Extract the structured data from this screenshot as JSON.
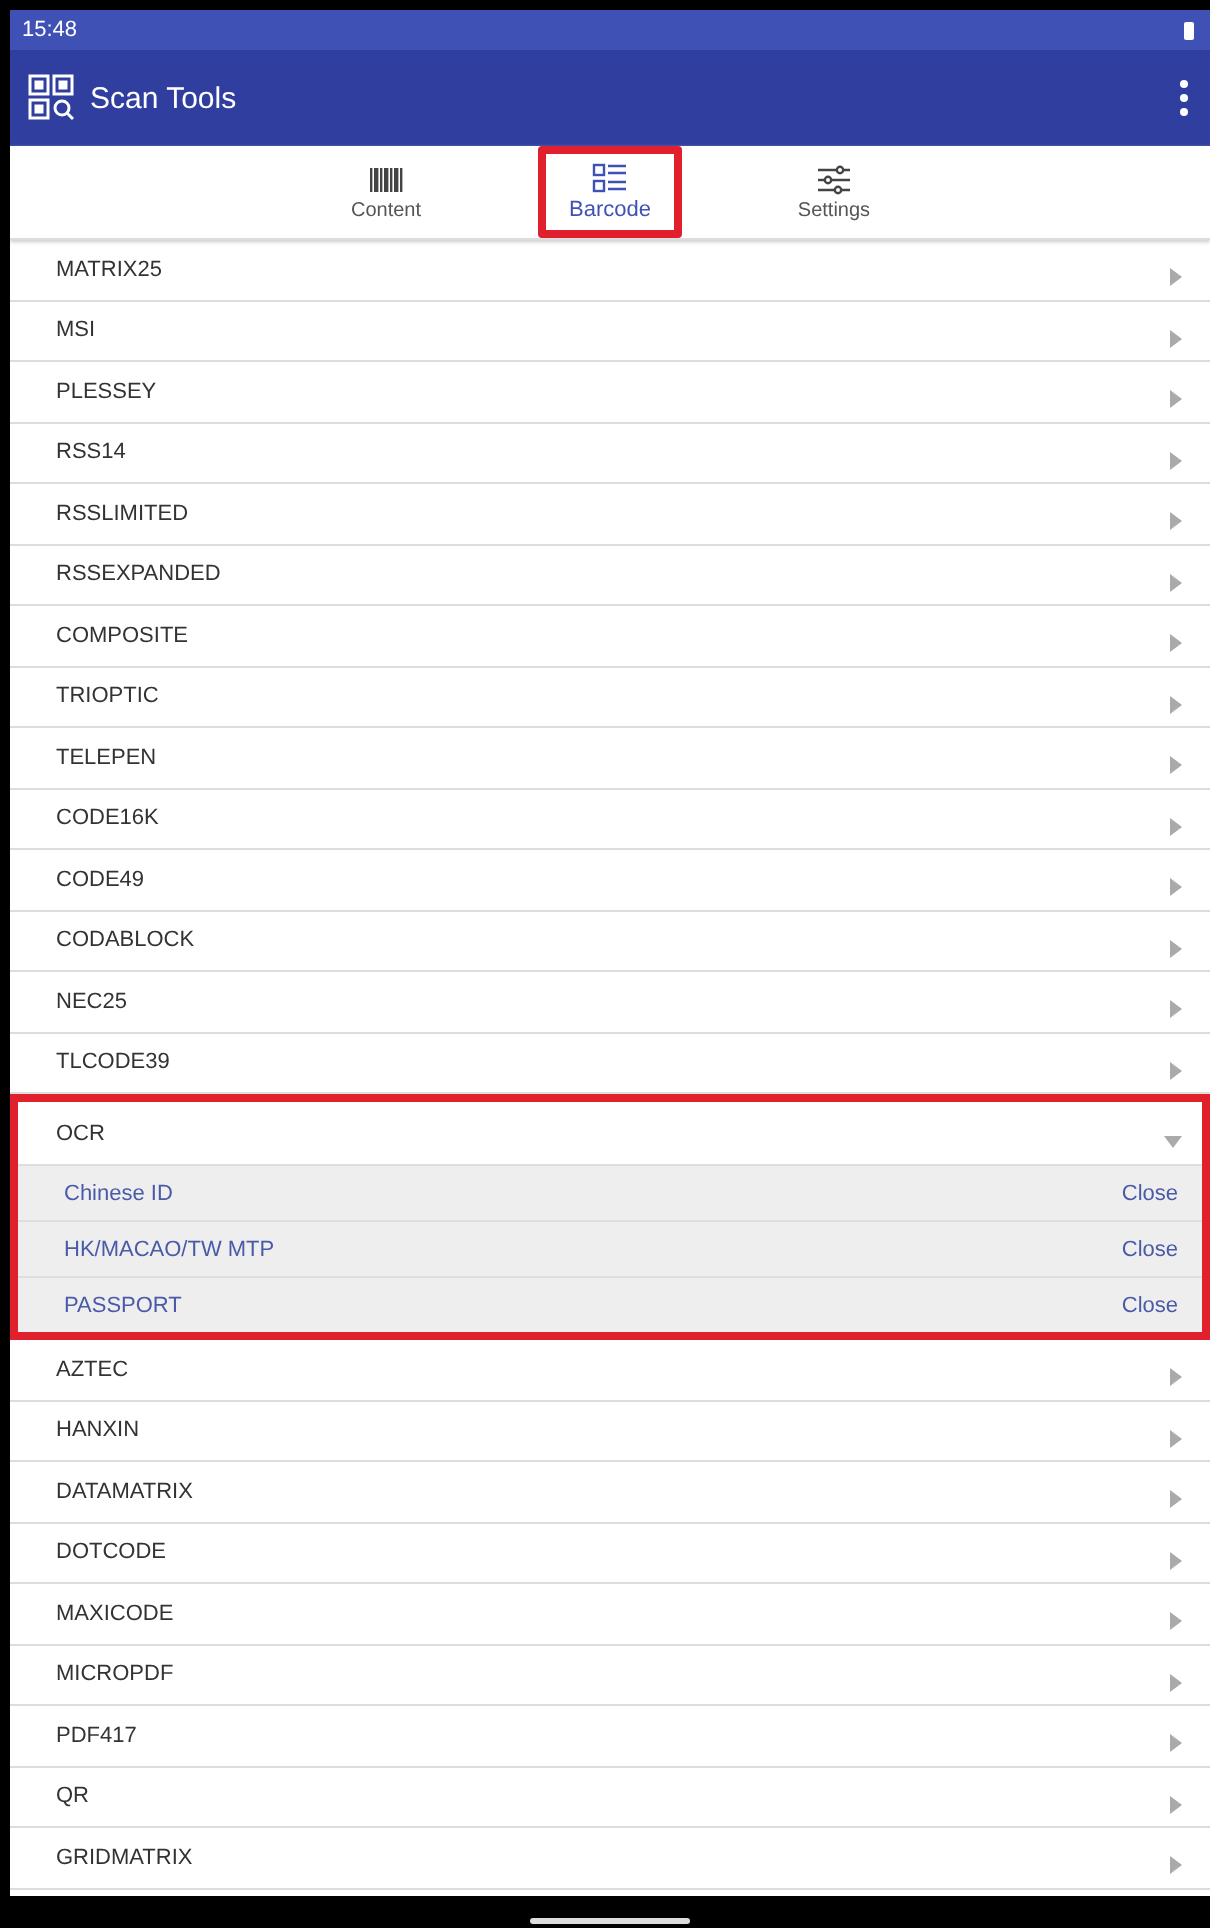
{
  "status_bar": {
    "time": "15:48"
  },
  "app_bar": {
    "title": "Scan Tools"
  },
  "tabs": [
    {
      "label": "Content",
      "kind": "barcode",
      "selected": false,
      "highlighted": false
    },
    {
      "label": "Barcode",
      "kind": "list",
      "selected": true,
      "highlighted": true
    },
    {
      "label": "Settings",
      "kind": "sliders",
      "selected": false,
      "highlighted": false
    }
  ],
  "items": [
    {
      "label": "MATRIX25",
      "kind": "item"
    },
    {
      "label": "MSI",
      "kind": "item"
    },
    {
      "label": "PLESSEY",
      "kind": "item"
    },
    {
      "label": "RSS14",
      "kind": "item"
    },
    {
      "label": "RSSLIMITED",
      "kind": "item"
    },
    {
      "label": "RSSEXPANDED",
      "kind": "item"
    },
    {
      "label": "COMPOSITE",
      "kind": "item"
    },
    {
      "label": "TRIOPTIC",
      "kind": "item"
    },
    {
      "label": "TELEPEN",
      "kind": "item"
    },
    {
      "label": "CODE16K",
      "kind": "item"
    },
    {
      "label": "CODE49",
      "kind": "item"
    },
    {
      "label": "CODABLOCK",
      "kind": "item"
    },
    {
      "label": "NEC25",
      "kind": "item"
    },
    {
      "label": "TLCODE39",
      "kind": "item"
    },
    {
      "label": "OCR",
      "kind": "group",
      "expanded": true,
      "highlighted": true,
      "children": [
        {
          "label": "Chinese ID",
          "status": "Close"
        },
        {
          "label": "HK/MACAO/TW MTP",
          "status": "Close"
        },
        {
          "label": "PASSPORT",
          "status": "Close"
        }
      ]
    },
    {
      "label": "AZTEC",
      "kind": "item"
    },
    {
      "label": "HANXIN",
      "kind": "item"
    },
    {
      "label": "DATAMATRIX",
      "kind": "item"
    },
    {
      "label": "DOTCODE",
      "kind": "item"
    },
    {
      "label": "MAXICODE",
      "kind": "item"
    },
    {
      "label": "MICROPDF",
      "kind": "item"
    },
    {
      "label": "PDF417",
      "kind": "item"
    },
    {
      "label": "QR",
      "kind": "item"
    },
    {
      "label": "GRIDMATRIX",
      "kind": "item"
    }
  ]
}
